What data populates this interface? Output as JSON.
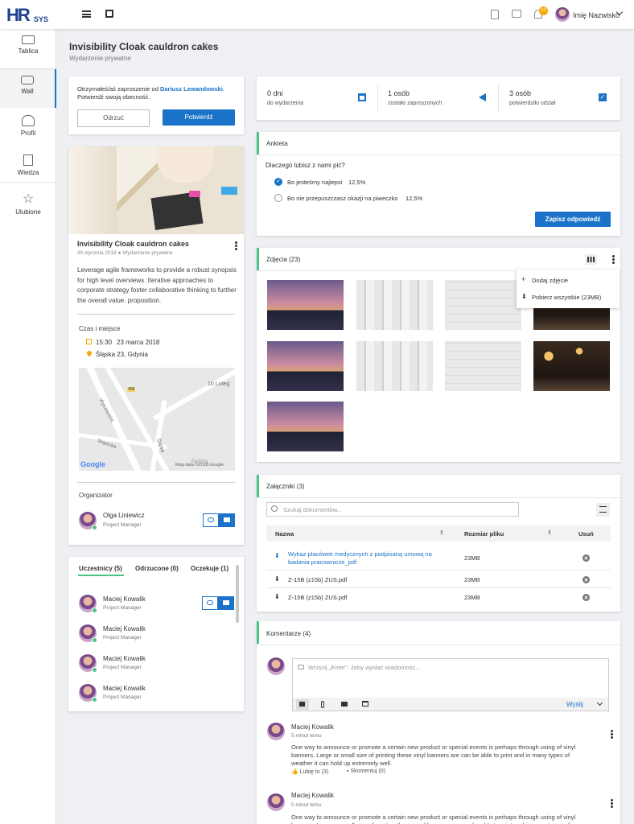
{
  "app": {
    "logo_main": "HR",
    "logo_sub": "SYS",
    "user_name": "Imię Nazwisko",
    "notif_count": "10"
  },
  "sidebar": {
    "items": [
      {
        "label": "Tablica"
      },
      {
        "label": "Wall"
      },
      {
        "label": "Profil"
      },
      {
        "label": "Wiedza"
      },
      {
        "label": "Ulubione"
      }
    ]
  },
  "page": {
    "title": "Invisibility Cloak cauldron cakes",
    "subtitle": "Wydarzenie prywatne"
  },
  "invite": {
    "text1": "Otrzymałeś/aś zaproszenie od ",
    "inviter": "Dariusz Lewandowski",
    "text2": ". Potwierdź swoją obecność.",
    "decline": "Odrzuć",
    "confirm": "Potwierdź"
  },
  "event": {
    "title": "Invisibility Cloak cauldron cakes",
    "meta": "30 stycznia 2018 ● Wydarzenie prywatne",
    "description": "Leverage agile frameworks to provide a robust synopsis for high level overviews. Iterative approaches to corporate strategy foster collaborative thinking to further the overall value. proposition.",
    "time_label": "Czas i miejsce",
    "time": "15:30",
    "date": "23 marca 2018",
    "place": "Śląska 23, Gdynia",
    "map_labels": {
      "road": "468",
      "street1": "Wyszawska",
      "street2": "Słupecka",
      "street3": "Śląska",
      "area": "10 Luteg",
      "google": "Google",
      "copy": "Map data ©2018 Google",
      "poi": "Parking"
    },
    "organizer_label": "Organizator",
    "organizer": {
      "name": "Olga Liniewicz",
      "role": "Project Manager"
    }
  },
  "participants": {
    "tabs": [
      "Uczestnicy (5)",
      "Odrzucone (0)",
      "Oczekuje (1)"
    ],
    "list": [
      {
        "name": "Maciej Kowalik",
        "role": "Project Manager"
      },
      {
        "name": "Maciej Kowalik",
        "role": "Project Manager"
      },
      {
        "name": "Maciej Kowalik",
        "role": "Project Manager"
      },
      {
        "name": "Maciej Kowalik",
        "role": "Project Manager"
      }
    ]
  },
  "stats": [
    {
      "value": "0 dni",
      "label": "do wydarzenia"
    },
    {
      "value": "1 osób",
      "label": "zostało zaproszonych"
    },
    {
      "value": "3 osób",
      "label": "potwierdziło udział"
    }
  ],
  "poll": {
    "title": "Ankieta",
    "question": "Dlaczego lubisz z nami pić?",
    "options": [
      {
        "label": "Bo jesteśmy najlepsi",
        "pct": "12,5%",
        "checked": true
      },
      {
        "label": "Bo nie przepuszczasz okazji na piweczko",
        "pct": "12,5%",
        "checked": false
      }
    ],
    "submit": "Zapisz odpowiedź"
  },
  "photos": {
    "title": "Zdjęcia (23)",
    "menu": [
      "Dodaj zdjęcie",
      "Pobierz wszystkie (23MB)"
    ]
  },
  "attachments": {
    "title": "Załączniki (3)",
    "search_placeholder": "Szukaj dokumentów...",
    "cols": [
      "Nazwa",
      "Rozmiar pliku",
      "Usuń"
    ],
    "files": [
      {
        "name": "Wykaz placówek medycznych z podpisaną umową na badania pracownicze_pdf",
        "size": "23MB",
        "link": true
      },
      {
        "name": "Z-15B (z15b) ZUS.pdf",
        "size": "23MB",
        "link": false
      },
      {
        "name": "Z-15B (z15b) ZUS.pdf",
        "size": "23MB",
        "link": false
      }
    ]
  },
  "comments": {
    "title": "Komentarze (4)",
    "input_placeholder": "Wciśnij „Enter\", żeby wysłać wiadomość...",
    "send": "Wyślij",
    "items": [
      {
        "author": "Maciej Kowalik",
        "time": "5 minut temu",
        "text": "One way to announce or promote a certain new product or special events is perhaps through using of vinyl banners. Large or small size of printing these vinyl banners are can be able to print and in many types of weather it can hold up extremely well.",
        "like": "Lubię to (3)",
        "comment": "Skomentuj (0)"
      },
      {
        "author": "Maciej Kowalik",
        "time": "5 minut temu",
        "text": "One way to announce or promote a certain new product or special events is perhaps through using of vinyl banners. Large or small size of printing these vinyl banners are can be able to print and in many types of weather it can hold up extremely well."
      }
    ]
  }
}
